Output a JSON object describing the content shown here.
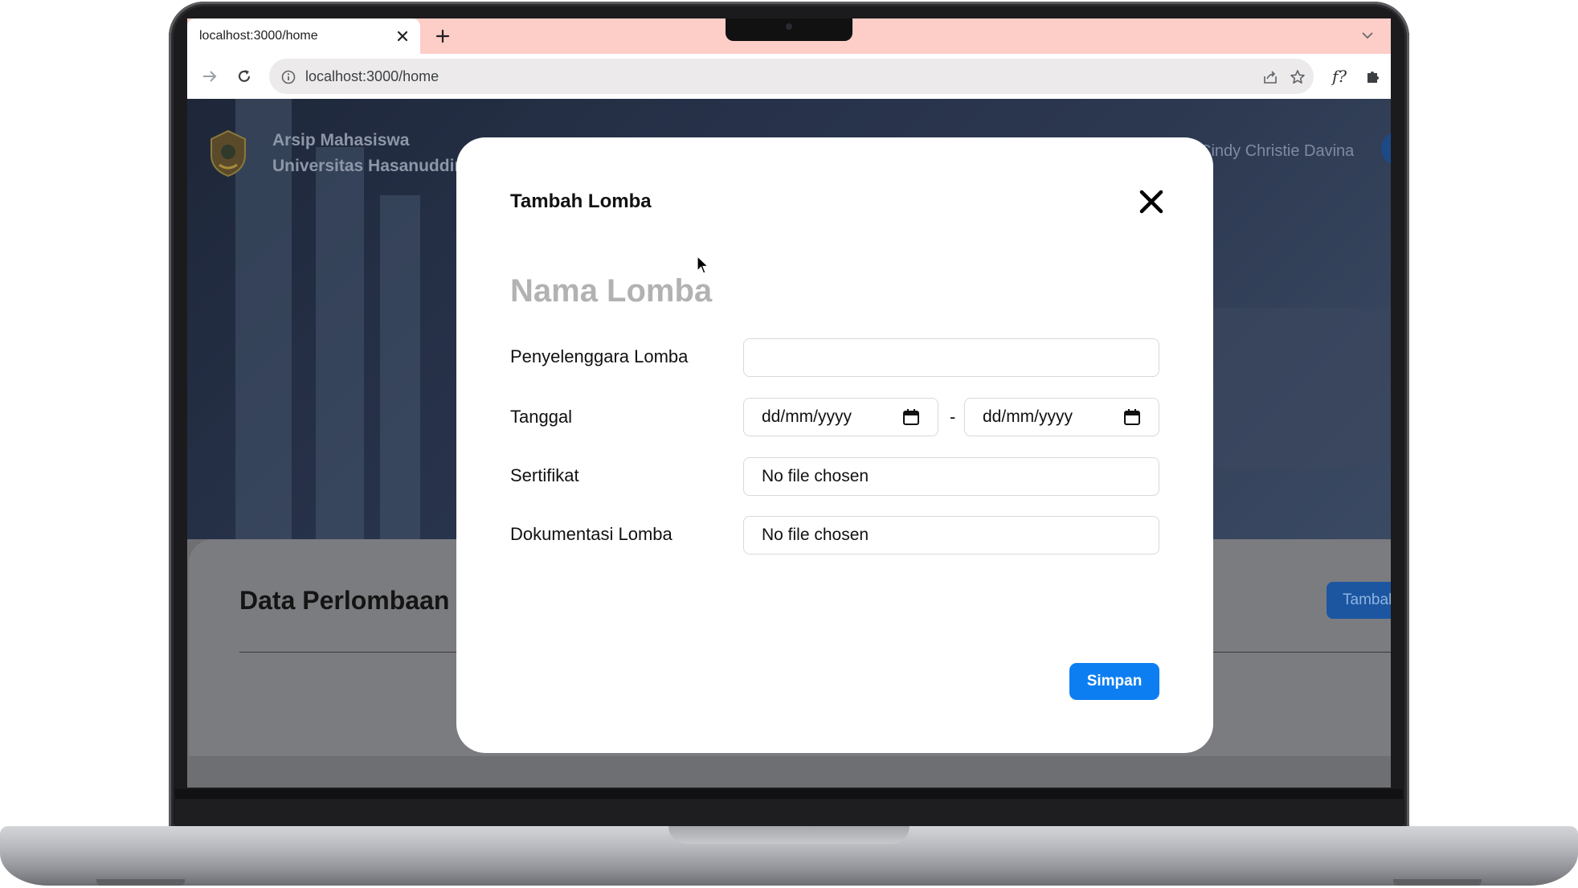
{
  "browser": {
    "tab_title": "localhost:3000/home",
    "url": "localhost:3000/home",
    "ext_label": "f?"
  },
  "page": {
    "app_title_line1": "Arsip Mahasiswa",
    "app_title_line2": "Universitas Hasanuddin",
    "user_name": "Cindy Christie Davina",
    "section_title": "Data Perlombaan",
    "add_button_label": "Tambah"
  },
  "modal": {
    "title": "Tambah Lomba",
    "name_placeholder": "Nama Lomba",
    "fields": {
      "organizer_label": "Penyelenggara Lomba",
      "organizer_value": "",
      "date_label": "Tanggal",
      "date_start": "dd/mm/yyyy",
      "date_separator": "-",
      "date_end": "dd/mm/yyyy",
      "certificate_label": "Sertifikat",
      "certificate_value": "No file chosen",
      "documentation_label": "Dokumentasi Lomba",
      "documentation_value": "No file chosen"
    },
    "save_label": "Simpan"
  },
  "colors": {
    "tab_strip": "#fdcdc8",
    "save_button": "#0d7ef2",
    "overlay_hero": "#27324a"
  },
  "icons": [
    "close-icon",
    "plus-icon",
    "chevron-down-icon",
    "back-icon",
    "reload-icon",
    "info-icon",
    "share-icon",
    "star-icon",
    "puzzle-icon",
    "calendar-icon",
    "cursor-icon"
  ]
}
